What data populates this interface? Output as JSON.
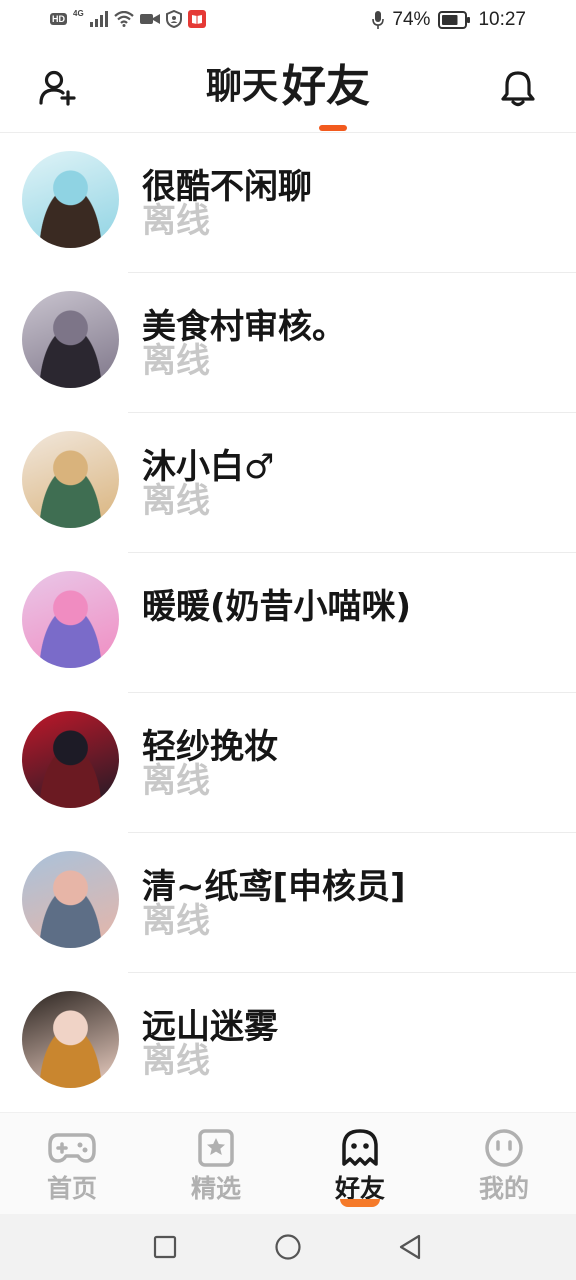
{
  "status_bar": {
    "hd": "HD",
    "network": "4G",
    "battery_text": "74%",
    "battery_level": 0.74,
    "time": "10:27",
    "icons": [
      "hd-icon",
      "signal-icon",
      "wifi-icon",
      "video-icon",
      "shield-icon",
      "book-app-icon",
      "mic-icon",
      "battery-icon"
    ]
  },
  "header": {
    "tabs": [
      {
        "label": "聊天",
        "active": false
      },
      {
        "label": "好友",
        "active": true
      }
    ],
    "left_icon": "add-user-icon",
    "right_icon": "bell-icon",
    "accent_color": "#f25a1e"
  },
  "friends": [
    {
      "name": "很酷不闲聊",
      "status": "离线",
      "avatar_colors": [
        "#dff3f7",
        "#8fd3e3",
        "#3a2a22"
      ]
    },
    {
      "name": "美食村审核。",
      "status": "离线",
      "avatar_colors": [
        "#c9c4cf",
        "#7d7588",
        "#2b2730"
      ]
    },
    {
      "name": "沐小白♂",
      "status": "离线",
      "avatar_colors": [
        "#f1e7dc",
        "#d9b37c",
        "#3f6e52"
      ]
    },
    {
      "name": "暖暖(奶昔小喵咪)",
      "status": "",
      "avatar_colors": [
        "#e9c7e8",
        "#f08cc1",
        "#7a6bc9"
      ]
    },
    {
      "name": "轻纱挽妆",
      "status": "离线",
      "avatar_colors": [
        "#c0182a",
        "#1d1b26",
        "#6b1a22"
      ]
    },
    {
      "name": "清~纸鸢[申核员]",
      "status": "离线",
      "avatar_colors": [
        "#a9c2db",
        "#e7b5a7",
        "#5d6e86"
      ]
    },
    {
      "name": "远山迷雾",
      "status": "离线",
      "avatar_colors": [
        "#2b2420",
        "#f0d3c6",
        "#c9862f"
      ]
    }
  ],
  "bottom_nav": [
    {
      "label": "首页",
      "icon": "gamepad-icon",
      "active": false
    },
    {
      "label": "精选",
      "icon": "star-badge-icon",
      "active": false
    },
    {
      "label": "好友",
      "icon": "ghost-icon",
      "active": true
    },
    {
      "label": "我的",
      "icon": "face-icon",
      "active": false
    }
  ],
  "system_nav": {
    "icons": [
      "recent-apps-icon",
      "home-icon",
      "back-icon"
    ]
  },
  "colors": {
    "text_primary": "#161616",
    "text_status": "#c8c8c8",
    "nav_inactive": "#b0b0b0",
    "accent": "#f25a1e"
  }
}
